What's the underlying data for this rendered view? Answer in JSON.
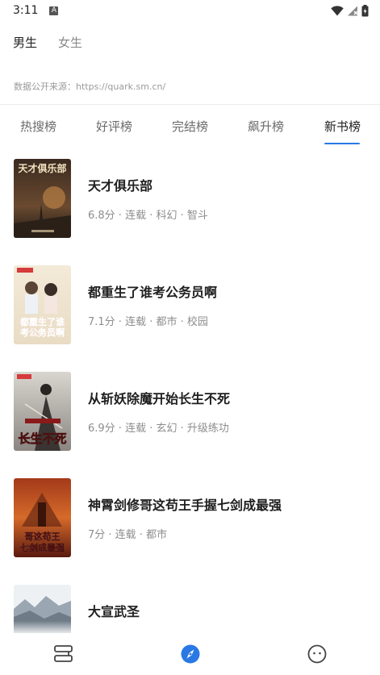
{
  "status_bar": {
    "time": "3:11",
    "notification_badge": "A"
  },
  "gender_tabs": [
    {
      "label": "男生",
      "active": true
    },
    {
      "label": "女生",
      "active": false
    }
  ],
  "source_note": "数据公开来源：https://quark.sm.cn/",
  "rank_tabs": [
    {
      "label": "热搜榜",
      "active": false
    },
    {
      "label": "好评榜",
      "active": false
    },
    {
      "label": "完结榜",
      "active": false
    },
    {
      "label": "飙升榜",
      "active": false
    },
    {
      "label": "新书榜",
      "active": true
    }
  ],
  "books": [
    {
      "title": "天才俱乐部",
      "meta": "6.8分 · 连载 · 科幻 · 智斗",
      "cover_text": "天才俱乐部"
    },
    {
      "title": "都重生了谁考公务员啊",
      "meta": "7.1分 · 连载 · 都市 · 校园",
      "cover_text": "都重生了谁考公务员啊"
    },
    {
      "title": "从斩妖除魔开始长生不死",
      "meta": "6.9分 · 连载 · 玄幻 · 升级练功",
      "cover_text": "长生不死"
    },
    {
      "title": "神霄剑修哥这苟王手握七剑成最强",
      "meta": "7分 · 连载 · 都市",
      "cover_text": "哥这苟王七剑成最强"
    },
    {
      "title": "大宣武圣",
      "meta": "",
      "cover_text": ""
    }
  ],
  "bottom_nav": [
    {
      "icon": "bookshelf-icon",
      "active": false
    },
    {
      "icon": "compass-icon",
      "active": true,
      "accent": "#2a78e4"
    },
    {
      "icon": "smiley-icon",
      "active": false
    }
  ],
  "colors": {
    "accent": "#2a78e4"
  }
}
